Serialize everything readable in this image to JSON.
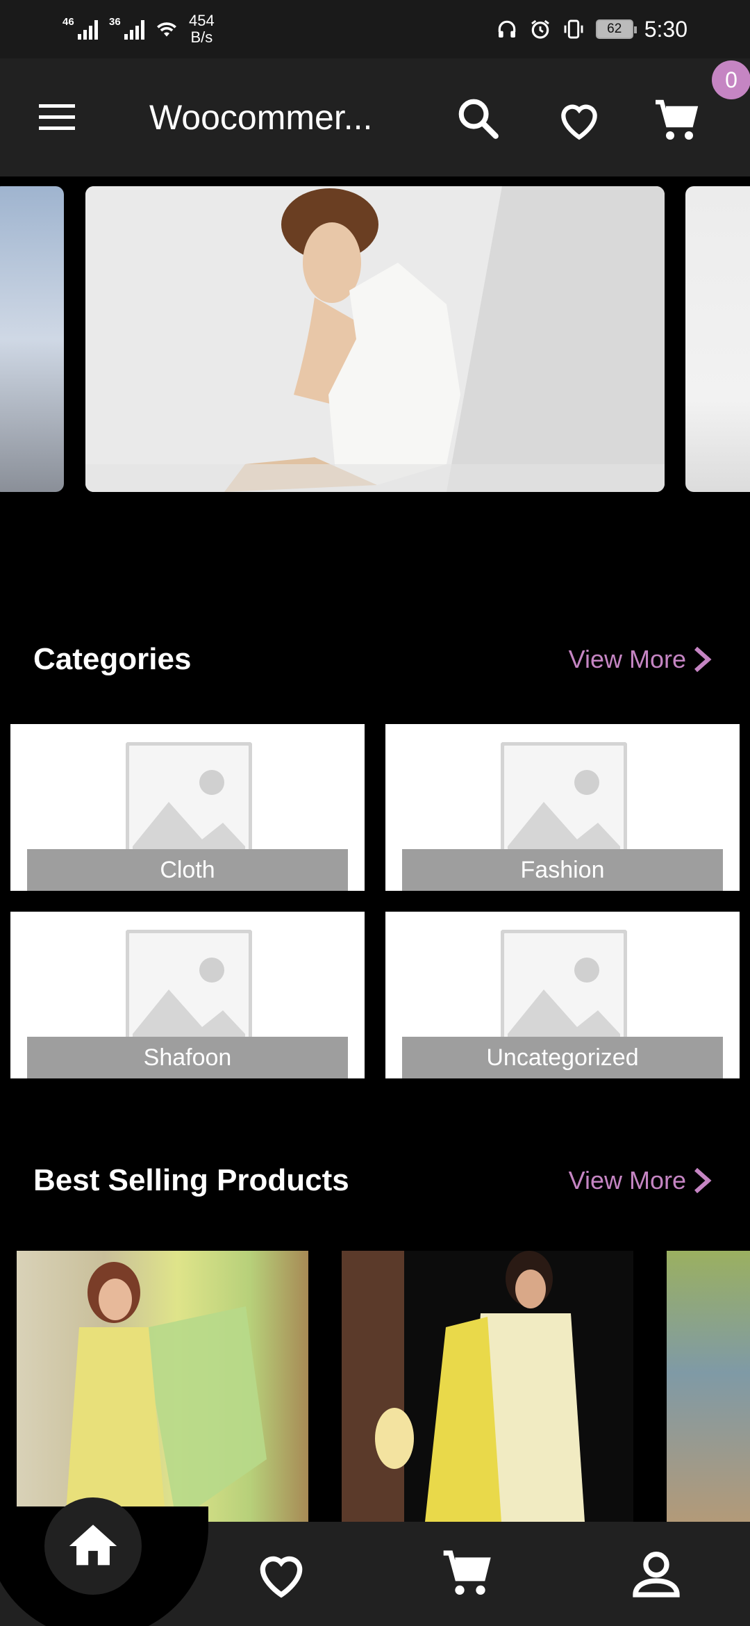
{
  "status_bar": {
    "network_left": "46",
    "network_right": "36",
    "net_speed_value": "454",
    "net_speed_unit": "B/s",
    "battery": "62",
    "time": "5:30"
  },
  "app_bar": {
    "title": "Woocommer...",
    "cart_count": "0"
  },
  "categories": {
    "title": "Categories",
    "view_more": "View More",
    "items": [
      {
        "label": "Cloth"
      },
      {
        "label": "Fashion"
      },
      {
        "label": "Shafoon"
      },
      {
        "label": "Uncategorized"
      }
    ]
  },
  "best_selling": {
    "title": "Best Selling Products",
    "view_more": "View More"
  },
  "colors": {
    "accent": "#c585c3",
    "app_bar_bg": "#212121",
    "background": "#000000",
    "tile_label_bg": "#9e9e9e"
  },
  "icons": {
    "menu": "menu-icon",
    "search": "search-icon",
    "favorite": "heart-icon",
    "cart": "cart-icon",
    "home": "home-icon",
    "account": "person-icon"
  }
}
